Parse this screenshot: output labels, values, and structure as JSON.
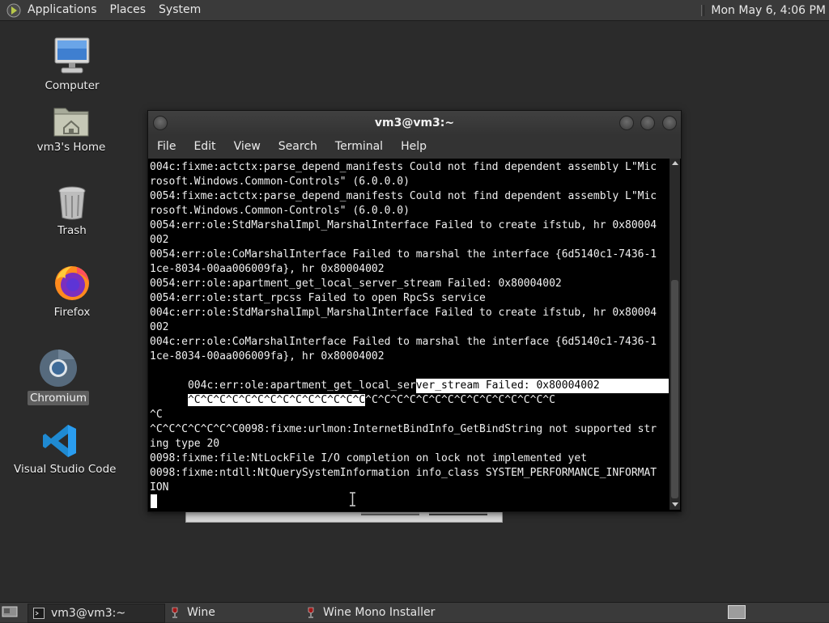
{
  "top_panel": {
    "menus": [
      "Applications",
      "Places",
      "System"
    ],
    "clock": "Mon May 6,  4:06 PM"
  },
  "desktop": {
    "icons": [
      {
        "label": "Computer",
        "icon": "computer-icon"
      },
      {
        "label": "vm3's Home",
        "icon": "home-folder-icon"
      },
      {
        "label": "Trash",
        "icon": "trash-icon"
      },
      {
        "label": "Firefox",
        "icon": "firefox-icon"
      },
      {
        "label": "Chromium",
        "icon": "chromium-icon",
        "selected": true
      },
      {
        "label": "Visual Studio Code",
        "icon": "vscode-icon"
      }
    ]
  },
  "terminal": {
    "title": "vm3@vm3:~",
    "menu": [
      "File",
      "Edit",
      "View",
      "Search",
      "Terminal",
      "Help"
    ],
    "lines": [
      "004c:fixme:actctx:parse_depend_manifests Could not find dependent assembly L\"Mic",
      "rosoft.Windows.Common-Controls\" (6.0.0.0)",
      "0054:fixme:actctx:parse_depend_manifests Could not find dependent assembly L\"Mic",
      "rosoft.Windows.Common-Controls\" (6.0.0.0)",
      "0054:err:ole:StdMarshalImpl_MarshalInterface Failed to create ifstub, hr 0x80004",
      "002",
      "0054:err:ole:CoMarshalInterface Failed to marshal the interface {6d5140c1-7436-1",
      "1ce-8034-00aa006009fa}, hr 0x80004002",
      "0054:err:ole:apartment_get_local_server_stream Failed: 0x80004002",
      "0054:err:ole:start_rpcss Failed to open RpcSs service",
      "004c:err:ole:StdMarshalImpl_MarshalInterface Failed to create ifstub, hr 0x80004",
      "002",
      "004c:err:ole:CoMarshalInterface Failed to marshal the interface {6d5140c1-7436-1",
      "1ce-8034-00aa006009fa}, hr 0x80004002",
      "004c:err:ole:apartment_get_local_ser",
      "ver_stream Failed: 0x80004002",
      "^C^C^C^C^C^C^C^C^C^C^C^C^C^C",
      "^C^C^C^C^C^C^C^C^C^C^C^C^C^C^C",
      "",
      "^C",
      "^C^C^C^C^C^C^C0098:fixme:urlmon:InternetBindInfo_GetBindString not supported str",
      "ing type 20",
      "0098:fixme:file:NtLockFile I/O completion on lock not implemented yet",
      "0098:fixme:ntdll:NtQuerySystemInformation info_class SYSTEM_PERFORMANCE_INFORMAT",
      "ION"
    ]
  },
  "taskbar": {
    "items": [
      "vm3@vm3:~",
      "Wine",
      "Wine Mono Installer"
    ]
  }
}
